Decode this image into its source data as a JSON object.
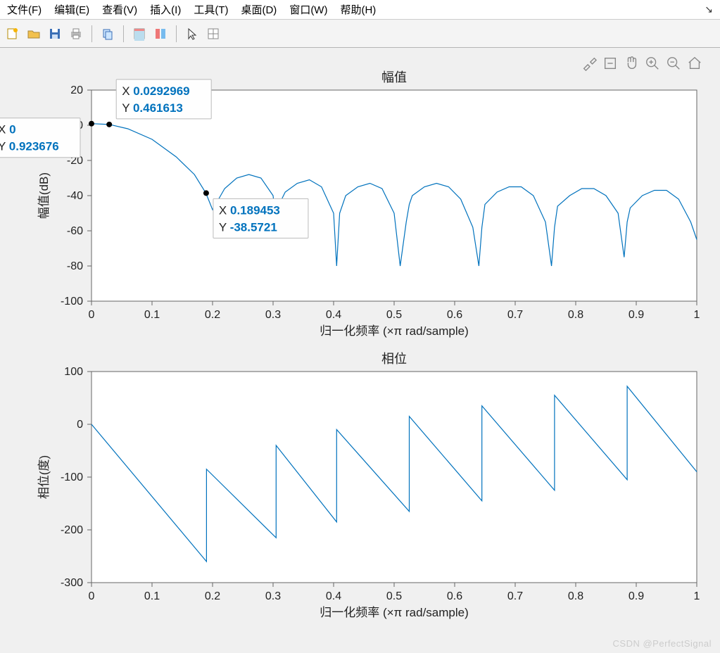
{
  "menu": {
    "items": [
      "文件(F)",
      "编辑(E)",
      "查看(V)",
      "插入(I)",
      "工具(T)",
      "桌面(D)",
      "窗口(W)",
      "帮助(H)"
    ]
  },
  "toolbar": {
    "icons": [
      "new",
      "open",
      "save",
      "print",
      "sep",
      "copy-fig",
      "sep",
      "data-cursor",
      "colorbar",
      "sep",
      "pointer",
      "rotate3d"
    ]
  },
  "axtoolbar": {
    "icons": [
      "brush",
      "rect-zoom",
      "pan",
      "zoom-in",
      "zoom-out",
      "home"
    ]
  },
  "chart_data": [
    {
      "type": "line",
      "title": "幅值",
      "xlabel": "归一化频率  (×π rad/sample)",
      "ylabel": "幅值(dB)",
      "xlim": [
        0,
        1
      ],
      "ylim": [
        -100,
        20
      ],
      "xticks": [
        0,
        0.1,
        0.2,
        0.3,
        0.4,
        0.5,
        0.6,
        0.7,
        0.8,
        0.9,
        1
      ],
      "yticks": [
        -100,
        -80,
        -60,
        -40,
        -20,
        0,
        20
      ],
      "x": [
        0,
        0.0293,
        0.06,
        0.1,
        0.14,
        0.17,
        0.189,
        0.2,
        0.21,
        0.22,
        0.24,
        0.26,
        0.28,
        0.3,
        0.305,
        0.31,
        0.32,
        0.34,
        0.36,
        0.38,
        0.4,
        0.405,
        0.41,
        0.42,
        0.44,
        0.46,
        0.48,
        0.5,
        0.51,
        0.52,
        0.525,
        0.53,
        0.55,
        0.57,
        0.59,
        0.61,
        0.63,
        0.64,
        0.645,
        0.65,
        0.67,
        0.69,
        0.71,
        0.73,
        0.75,
        0.76,
        0.765,
        0.77,
        0.79,
        0.81,
        0.83,
        0.85,
        0.87,
        0.88,
        0.885,
        0.89,
        0.91,
        0.93,
        0.95,
        0.97,
        0.99,
        1.0
      ],
      "y": [
        0.924,
        0.462,
        -2,
        -8,
        -18,
        -28,
        -38.57,
        -48,
        -42,
        -36,
        -30,
        -28,
        -30,
        -40,
        -55,
        -45,
        -38,
        -33,
        -31,
        -35,
        -50,
        -80,
        -50,
        -40,
        -35,
        -33,
        -36,
        -50,
        -80,
        -55,
        -45,
        -40,
        -35,
        -33,
        -35,
        -42,
        -58,
        -80,
        -58,
        -45,
        -38,
        -35,
        -35,
        -40,
        -55,
        -80,
        -58,
        -46,
        -40,
        -36,
        -36,
        -40,
        -50,
        -75,
        -55,
        -47,
        -40,
        -37,
        -37,
        -42,
        -55,
        -65
      ],
      "datatips": [
        {
          "x": 0,
          "y": 0.923676,
          "xlabel": "X",
          "ylabel": "Y",
          "xval": "0",
          "yval": "0.923676",
          "anchor": "left"
        },
        {
          "x": 0.0292969,
          "y": 0.461613,
          "xlabel": "X",
          "ylabel": "Y",
          "xval": "0.0292969",
          "yval": "0.461613",
          "anchor": "top-right"
        },
        {
          "x": 0.189453,
          "y": -38.5721,
          "xlabel": "X",
          "ylabel": "Y",
          "xval": "0.189453",
          "yval": "-38.5721",
          "anchor": "bottom-right"
        }
      ]
    },
    {
      "type": "line",
      "title": "相位",
      "xlabel": "归一化频率  (×π rad/sample)",
      "ylabel": "相位(度)",
      "xlim": [
        0,
        1
      ],
      "ylim": [
        -300,
        100
      ],
      "xticks": [
        0,
        0.1,
        0.2,
        0.3,
        0.4,
        0.5,
        0.6,
        0.7,
        0.8,
        0.9,
        1
      ],
      "yticks": [
        -300,
        -200,
        -100,
        0,
        100
      ],
      "x": [
        0,
        0.19,
        0.19,
        0.305,
        0.305,
        0.405,
        0.405,
        0.525,
        0.525,
        0.645,
        0.645,
        0.765,
        0.765,
        0.885,
        0.885,
        1.0
      ],
      "y": [
        0,
        -260,
        -85,
        -215,
        -40,
        -185,
        -10,
        -165,
        15,
        -145,
        35,
        -125,
        55,
        -105,
        72,
        -90
      ]
    }
  ],
  "watermark": "CSDN @PerfectSignal"
}
